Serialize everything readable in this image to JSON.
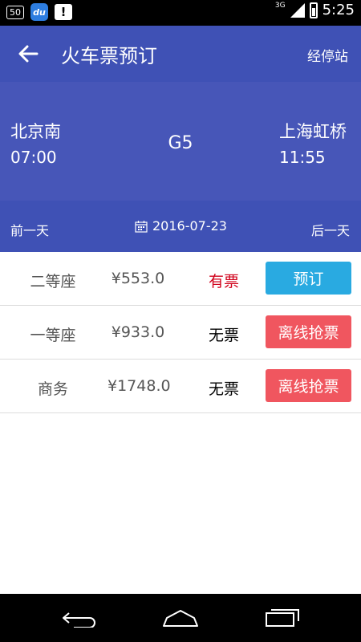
{
  "status_bar": {
    "notification_badge": "50",
    "du_app_label": "du",
    "message_icon_label": "!",
    "network": "3G",
    "time": "5:25"
  },
  "app_bar": {
    "title": "火车票预订",
    "stops_label": "经停站",
    "back_icon": "arrow-left-icon"
  },
  "train": {
    "departure_station": "北京南",
    "departure_time": "07:00",
    "train_number": "G5",
    "arrival_station": "上海虹桥",
    "arrival_time": "11:55"
  },
  "date_bar": {
    "prev_day_label": "前一天",
    "date": "2016-07-23",
    "next_day_label": "后一天",
    "calendar_icon": "calendar-icon"
  },
  "seats": [
    {
      "type": "二等座",
      "price": "¥553.0",
      "availability": "有票",
      "availability_color": "#d0021b",
      "action_label": "预订",
      "action_color": "#29aae1"
    },
    {
      "type": "一等座",
      "price": "¥933.0",
      "availability": "无票",
      "availability_color": "#000000",
      "action_label": "离线抢票",
      "action_color": "#f0565f"
    },
    {
      "type": "商务",
      "price": "¥1748.0",
      "availability": "无票",
      "availability_color": "#000000",
      "action_label": "离线抢票",
      "action_color": "#f0565f"
    }
  ],
  "nav_bar": {
    "back_icon": "nav-back-icon",
    "home_icon": "nav-home-icon",
    "recent_icon": "nav-recent-apps-icon"
  },
  "colors": {
    "primary": "#3f51b5",
    "panel": "#4756b8",
    "book_button": "#29aae1",
    "grab_button": "#f0565f"
  }
}
